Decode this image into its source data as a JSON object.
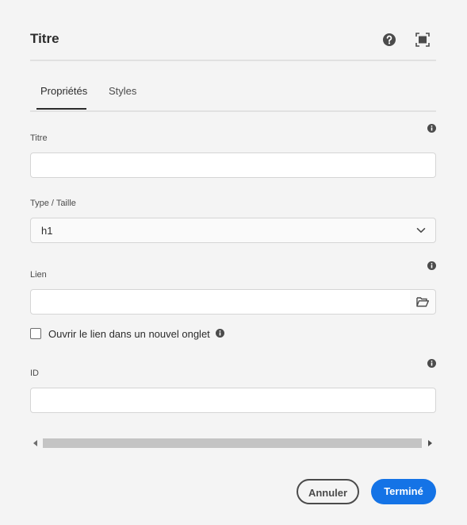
{
  "dialog": {
    "title": "Titre",
    "header_icons": [
      "help-icon",
      "fullscreen-icon"
    ]
  },
  "tabs": [
    {
      "label": "Propriétés",
      "active": true
    },
    {
      "label": "Styles",
      "active": false
    }
  ],
  "fields": {
    "title": {
      "label": "Titre",
      "value": ""
    },
    "type": {
      "label": "Type / Taille",
      "value": "h1"
    },
    "link": {
      "label": "Lien",
      "value": ""
    },
    "new_tab": {
      "label": "Ouvrir le lien dans un nouvel onglet",
      "checked": false
    },
    "id": {
      "label": "ID",
      "value": ""
    }
  },
  "buttons": {
    "cancel": "Annuler",
    "done": "Terminé"
  },
  "colors": {
    "accent": "#1473e6",
    "background": "#f4f4f4"
  }
}
